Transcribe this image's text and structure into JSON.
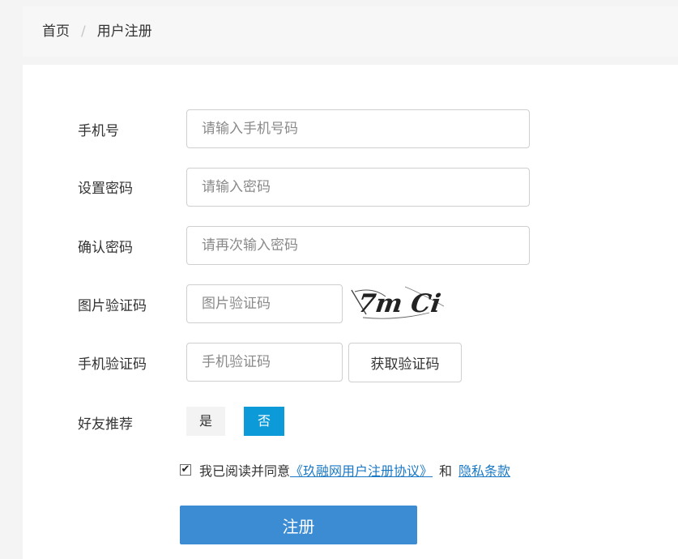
{
  "breadcrumb": {
    "home": "首页",
    "separator": "/",
    "current": "用户注册"
  },
  "form": {
    "phone": {
      "label": "手机号",
      "placeholder": "请输入手机号码",
      "value": ""
    },
    "password": {
      "label": "设置密码",
      "placeholder": "请输入密码",
      "value": ""
    },
    "confirm_password": {
      "label": "确认密码",
      "placeholder": "请再次输入密码",
      "value": ""
    },
    "image_captcha": {
      "label": "图片验证码",
      "placeholder": "图片验证码",
      "value": "",
      "captcha_image_text": "7m Ci"
    },
    "sms_code": {
      "label": "手机验证码",
      "placeholder": "手机验证码",
      "value": "",
      "get_code_label": "获取验证码"
    },
    "recommend": {
      "label": "好友推荐",
      "yes_label": "是",
      "no_label": "否",
      "selected": "否"
    }
  },
  "agreement": {
    "checked": true,
    "text": "我已阅读并同意",
    "user_agreement_link": "《玖融网用户注册协议》",
    "and_text": "和",
    "privacy_link": "隐私条款"
  },
  "submit_label": "注册",
  "colors": {
    "primary_button": "#3c8cd4",
    "selected_option": "#0d9ad8",
    "link": "#1979c6"
  }
}
